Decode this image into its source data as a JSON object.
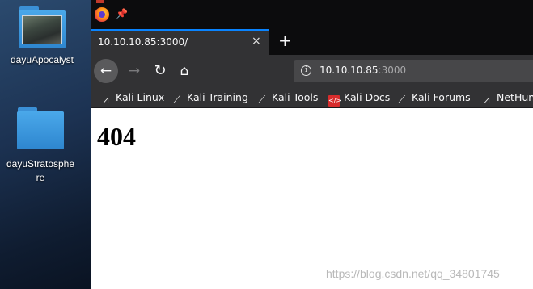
{
  "desktop": {
    "icons": [
      {
        "label": "dayuApocalyst"
      },
      {
        "label_line1": "dayuStratosphe",
        "label_line2": "re"
      }
    ]
  },
  "browser": {
    "tab": {
      "title": "10.10.10.85:3000/",
      "close": "×"
    },
    "new_tab": "+",
    "nav": {
      "back": "←",
      "forward": "→",
      "reload": "↻",
      "home": "⌂"
    },
    "url": {
      "info": "i",
      "host": "10.10.10.85",
      "port": ":3000"
    },
    "bookmarks": [
      {
        "label": "Kali Linux",
        "icon": "kali-dragon-icon"
      },
      {
        "label": "Kali Training",
        "icon": "kali-dragon-icon"
      },
      {
        "label": "Kali Tools",
        "icon": "kali-dragon-icon"
      },
      {
        "label": "Kali Docs",
        "icon": "docs-icon"
      },
      {
        "label": "Kali Forums",
        "icon": "kali-dragon-icon"
      },
      {
        "label": "NetHun",
        "icon": "kali-dragon-icon"
      }
    ]
  },
  "page": {
    "heading": "404",
    "watermark": "https://blog.csdn.net/qq_34801745"
  }
}
